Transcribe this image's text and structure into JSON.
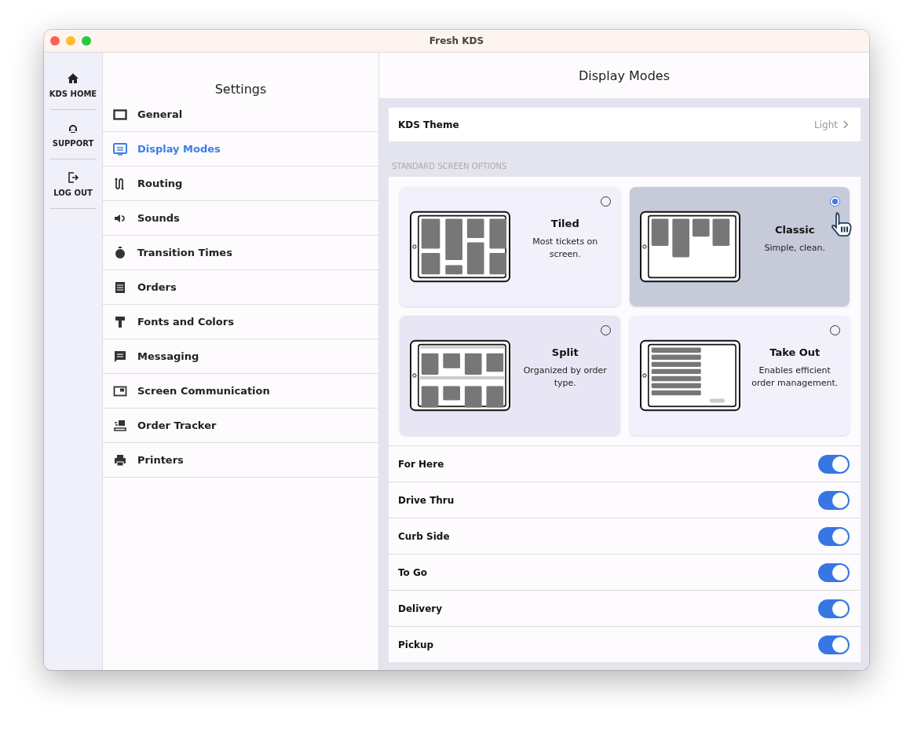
{
  "window": {
    "title": "Fresh KDS"
  },
  "rail": [
    {
      "label": "KDS HOME",
      "kind": "home"
    },
    {
      "label": "SUPPORT",
      "kind": "support"
    },
    {
      "label": "LOG OUT",
      "kind": "logout"
    }
  ],
  "settings": {
    "title": "Settings",
    "items": [
      {
        "label": "General",
        "selected": false
      },
      {
        "label": "Display Modes",
        "selected": true
      },
      {
        "label": "Routing",
        "selected": false
      },
      {
        "label": "Sounds",
        "selected": false
      },
      {
        "label": "Transition Times",
        "selected": false
      },
      {
        "label": "Orders",
        "selected": false
      },
      {
        "label": "Fonts and Colors",
        "selected": false
      },
      {
        "label": "Messaging",
        "selected": false
      },
      {
        "label": "Screen Communication",
        "selected": false
      },
      {
        "label": "Order Tracker",
        "selected": false
      },
      {
        "label": "Printers",
        "selected": false
      }
    ]
  },
  "detail": {
    "title": "Display Modes",
    "theme": {
      "label": "KDS Theme",
      "value": "Light"
    },
    "section_label": "STANDARD SCREEN OPTIONS",
    "modes": [
      {
        "kind": "tiled",
        "title": "Tiled",
        "description": "Most tickets on screen.",
        "selected": false
      },
      {
        "kind": "classic",
        "title": "Classic",
        "description": "Simple, clean.",
        "selected": true
      },
      {
        "kind": "split",
        "title": "Split",
        "description": "Organized by order type.",
        "selected": false
      },
      {
        "kind": "takeout",
        "title": "Take Out",
        "description": "Enables efficient order management.",
        "selected": false
      }
    ],
    "toggles": [
      {
        "label": "For Here",
        "on": true
      },
      {
        "label": "Drive Thru",
        "on": true
      },
      {
        "label": "Curb Side",
        "on": true
      },
      {
        "label": "To Go",
        "on": true
      },
      {
        "label": "Delivery",
        "on": true
      },
      {
        "label": "Pickup",
        "on": true
      }
    ]
  }
}
